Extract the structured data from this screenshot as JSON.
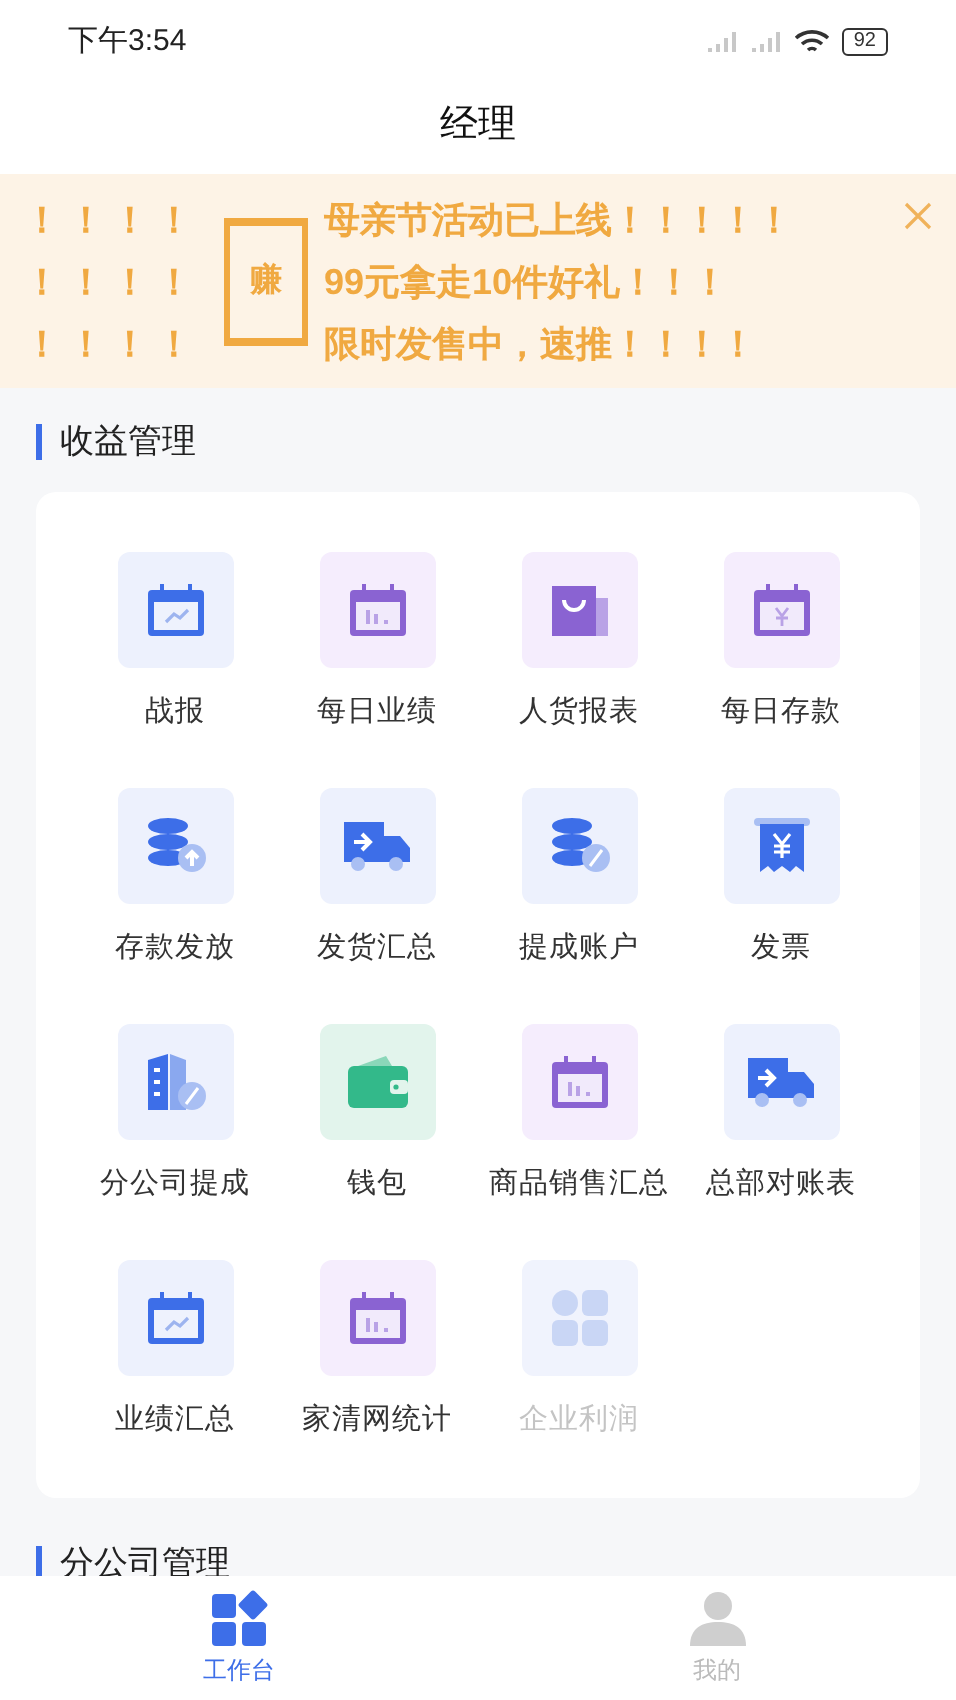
{
  "status_bar": {
    "time": "下午3:54",
    "battery": "92"
  },
  "title": "经理",
  "banner": {
    "badge": "赚",
    "lines": [
      {
        "prefix": "！！！！",
        "text": "母亲节活动已上线！！！！！"
      },
      {
        "prefix": "！！！！",
        "text": "99元拿走10件好礼！！！"
      },
      {
        "prefix": "！！！！",
        "text": "限时发售中，速推！！！！"
      }
    ]
  },
  "sections": [
    {
      "title": "收益管理",
      "items": [
        {
          "label": "战报",
          "kind": "calendar-trend",
          "disabled": false
        },
        {
          "label": "每日业绩",
          "kind": "calendar-bars",
          "disabled": false
        },
        {
          "label": "人货报表",
          "kind": "bag",
          "disabled": false
        },
        {
          "label": "每日存款",
          "kind": "calendar-yen",
          "disabled": false
        },
        {
          "label": "存款发放",
          "kind": "coins-up",
          "disabled": false
        },
        {
          "label": "发货汇总",
          "kind": "truck",
          "disabled": false
        },
        {
          "label": "提成账户",
          "kind": "coins-percent",
          "disabled": false
        },
        {
          "label": "发票",
          "kind": "receipt",
          "disabled": false
        },
        {
          "label": "分公司提成",
          "kind": "building",
          "disabled": false
        },
        {
          "label": "钱包",
          "kind": "wallet",
          "disabled": false
        },
        {
          "label": "商品销售汇总",
          "kind": "calendar-bars",
          "disabled": false
        },
        {
          "label": "总部对账表",
          "kind": "truck",
          "disabled": false
        },
        {
          "label": "业绩汇总",
          "kind": "calendar-trend",
          "disabled": false
        },
        {
          "label": "家清网统计",
          "kind": "calendar-bars",
          "disabled": false
        },
        {
          "label": "企业利润",
          "kind": "grid",
          "disabled": true
        }
      ]
    },
    {
      "title": "分公司管理"
    }
  ],
  "tabs": [
    {
      "label": "工作台",
      "kind": "workbench",
      "selected": true
    },
    {
      "label": "我的",
      "kind": "person",
      "selected": false
    }
  ]
}
